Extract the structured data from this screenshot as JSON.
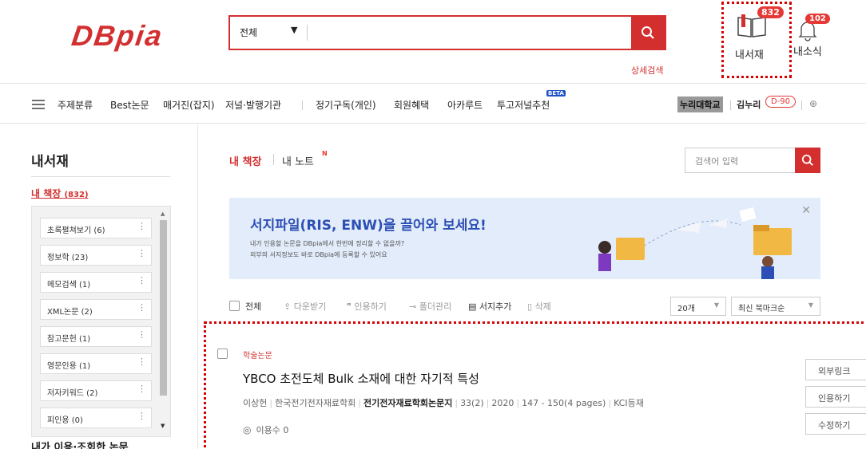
{
  "brand": {
    "logo": "DBpia",
    "accent": "#d32f2f"
  },
  "search": {
    "scope": "전체",
    "advanced": "상세검색"
  },
  "header": {
    "mylib": {
      "label": "내서재",
      "count": "832"
    },
    "notif": {
      "label": "내소식",
      "count": "102"
    }
  },
  "nav": {
    "items": [
      "주제분류",
      "Best논문",
      "매거진(잡지)",
      "저널·발행기관",
      "정기구독(개인)",
      "회원혜택",
      "아카루트",
      "투고저널추천"
    ],
    "beta": "BETA",
    "university": "누리대학교",
    "user": "김누리",
    "dday": "D-90"
  },
  "sidebar": {
    "title": "내서재",
    "mybook": "내 책장",
    "mybook_count": "(832)",
    "folders": [
      "초록펼쳐보기 (6)",
      "정보학 (23)",
      "메모검색 (1)",
      "XML논문 (2)",
      "참고문헌 (1)",
      "영문인용 (1)",
      "저자키워드 (2)",
      "피인용 (0)"
    ],
    "recent": "내가 이용·조회한 논문"
  },
  "main": {
    "tabs": {
      "mybook": "내 책장",
      "note": "내 노트",
      "note_badge": "N"
    },
    "search_placeholder": "검색어 입력",
    "banner": {
      "title": "서지파일(RIS, ENW)을 끌어와 보세요!",
      "sub1": "내가 인용할 논문을 DBpia에서 한번에 정리할 수 없을까?",
      "sub2": "외부의 서지정보도 바로 DBpia에 등록할 수 있어요"
    },
    "toolbar": {
      "all": "전체",
      "download": "다운받기",
      "cite": "인용하기",
      "folder": "폴더관리",
      "add_ref": "서지추가",
      "delete": "삭제",
      "per_page": "20개",
      "sort": "최신 북마크순"
    },
    "result": {
      "type": "학술논문",
      "title": "YBCO 초전도체 Bulk 소재에 대한 자기적 특성",
      "author": "이상헌",
      "publisher": "한국전기전자재료학회",
      "journal": "전기전자재료학회논문지",
      "volume": "33(2)",
      "year": "2020",
      "pages": "147 - 150(4 pages)",
      "index": "KCI등재",
      "views_label": "이용수",
      "views": "0",
      "buttons": [
        "외부링크",
        "인용하기",
        "수정하기"
      ]
    }
  }
}
